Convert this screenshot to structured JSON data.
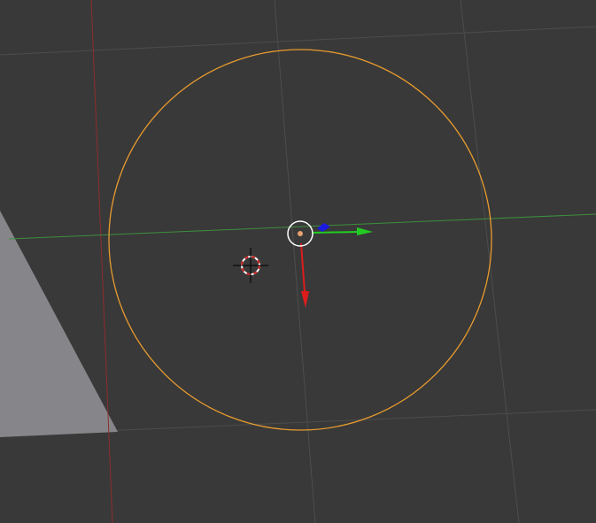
{
  "viewport": {
    "name": "3D Viewport",
    "background_color": "#393939",
    "grid_color": "#4d4d4d",
    "x_axis_color": "#8f2c2c",
    "y_axis_color": "#3d8f3d",
    "ground_plane_color": "#86868a"
  },
  "selected_object": {
    "type": "circle",
    "state": "selected",
    "outline_color": "#e89b2e"
  },
  "origin": {
    "color": "#e8a070"
  },
  "gizmo": {
    "mode": "translate",
    "x_color": "#dd1c1c",
    "y_color": "#22cc22",
    "z_color": "#1a1ae0",
    "center_ring_color": "#ffffff"
  },
  "cursor_3d": {
    "ring_colors": [
      "#ffffff",
      "#d42020"
    ],
    "crosshair_color": "#000000"
  }
}
